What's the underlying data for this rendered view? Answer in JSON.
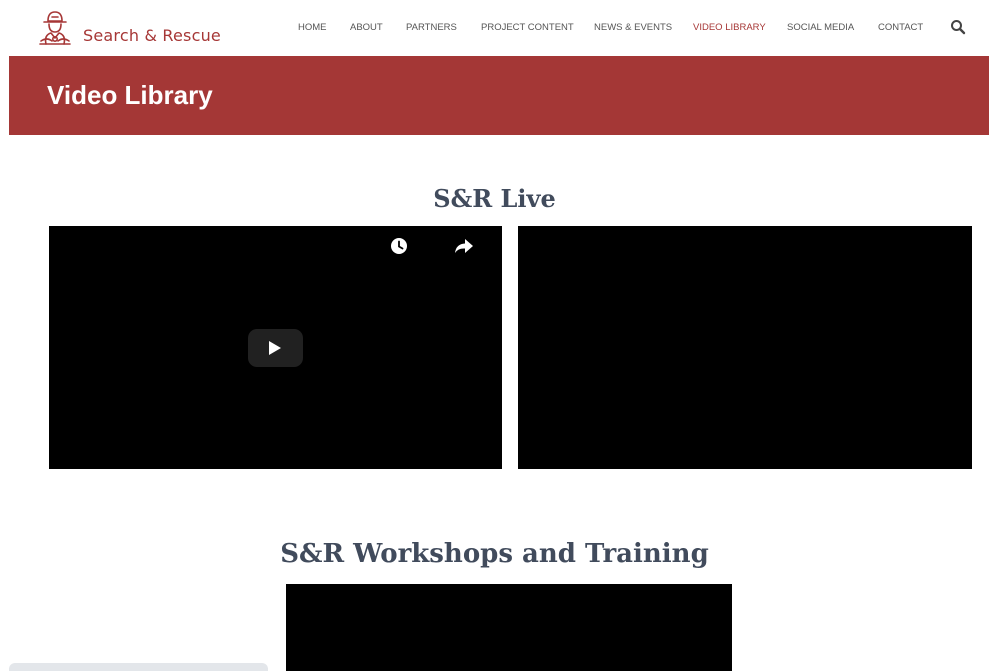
{
  "site": {
    "logo_text": "Search & Rescue",
    "logo_icon": "firefighter-helmet-icon"
  },
  "nav": {
    "items": [
      {
        "label": "HOME"
      },
      {
        "label": "ABOUT"
      },
      {
        "label": "PARTNERS"
      },
      {
        "label": "PROJECT CONTENT"
      },
      {
        "label": "NEWS & EVENTS"
      },
      {
        "label": "VIDEO LIBRARY",
        "active": true
      },
      {
        "label": "SOCIAL MEDIA"
      },
      {
        "label": "CONTACT"
      }
    ],
    "search_icon": "search-icon"
  },
  "banner": {
    "title": "Video Library"
  },
  "sections": [
    {
      "title": "S&R Live"
    },
    {
      "title": "S&R Workshops and Training"
    }
  ],
  "video_controls": {
    "play_icon": "play-icon",
    "watch_later_icon": "clock-icon",
    "share_icon": "share-arrow-icon"
  },
  "colors": {
    "brand": "#a63736",
    "banner": "#a43736",
    "heading": "#414b5c",
    "nav_text": "#555555"
  }
}
